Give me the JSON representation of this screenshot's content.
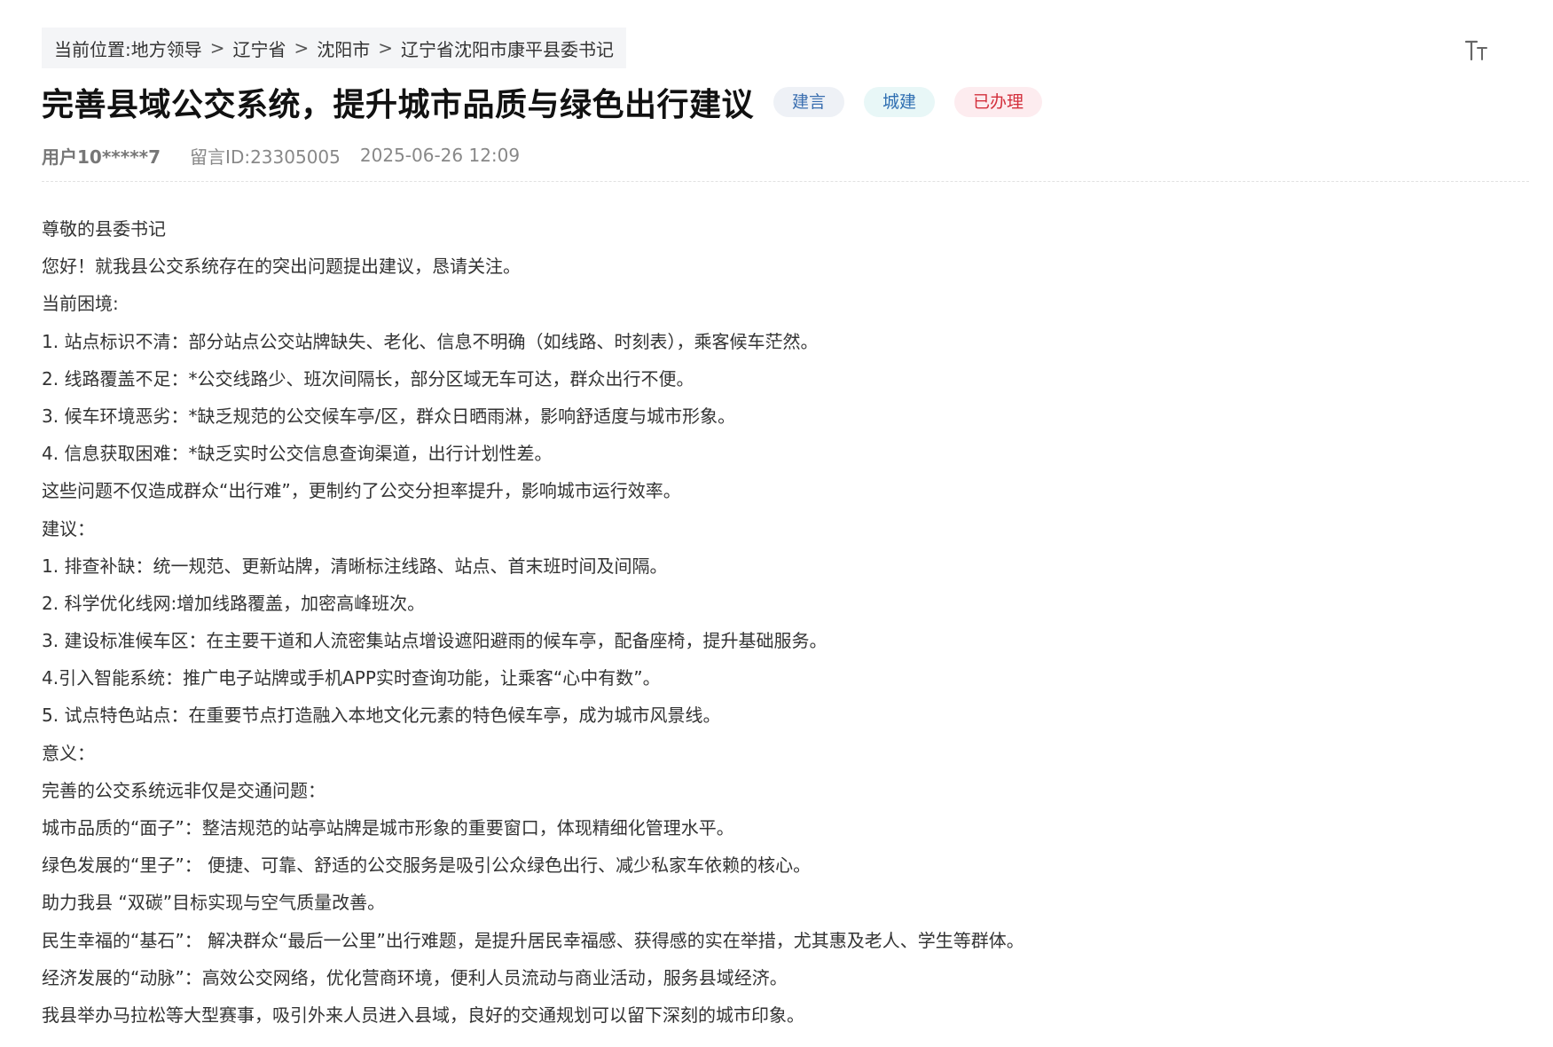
{
  "breadcrumb": {
    "prefix": "当前位置:",
    "items": [
      "地方领导",
      "辽宁省",
      "沈阳市",
      "辽宁省沈阳市康平县委书记"
    ],
    "separator": ">"
  },
  "toolbar": {
    "font_size_icon": "font-size-icon"
  },
  "post": {
    "title": "完善县域公交系统，提升城市品质与绿色出行建议",
    "tags": {
      "type": "建言",
      "category": "城建",
      "status": "已办理"
    },
    "meta": {
      "user": "用户10*****7",
      "message_id": "留言ID:23305005",
      "datetime": "2025-06-26 12:09"
    },
    "body": [
      "尊敬的县委书记",
      "您好！就我县公交系统存在的突出问题提出建议，恳请关注。",
      "当前困境:",
      "1.  站点标识不清：部分站点公交站牌缺失、老化、信息不明确（如线路、时刻表），乘客候车茫然。",
      "2.  线路覆盖不足：*公交线路少、班次间隔长，部分区域无车可达，群众出行不便。",
      "3.  候车环境恶劣：*缺乏规范的公交候车亭/区，群众日晒雨淋，影响舒适度与城市形象。",
      "4.  信息获取困难：*缺乏实时公交信息查询渠道，出行计划性差。",
      "这些问题不仅造成群众“出行难”，更制约了公交分担率提升，影响城市运行效率。",
      "建议：",
      "1.  排查补缺：统一规范、更新站牌，清晰标注线路、站点、首末班时间及间隔。",
      "2.  科学优化线网:增加线路覆盖，加密高峰班次。",
      "3.  建设标准候车区：在主要干道和人流密集站点增设遮阳避雨的候车亭，配备座椅，提升基础服务。",
      "4.引入智能系统：推广电子站牌或手机APP实时查询功能，让乘客“心中有数”。",
      "5. 试点特色站点：在重要节点打造融入本地文化元素的特色候车亭，成为城市风景线。",
      "意义：",
      "完善的公交系统远非仅是交通问题：",
      "城市品质的“面子”：整洁规范的站亭站牌是城市形象的重要窗口，体现精细化管理水平。",
      "绿色发展的“里子”： 便捷、可靠、舒适的公交服务是吸引公众绿色出行、减少私家车依赖的核心。",
      "助力我县 “双碳”目标实现与空气质量改善。",
      "民生幸福的“基石”： 解决群众“最后一公里”出行难题，是提升居民幸福感、获得感的实在举措，尤其惠及老人、学生等群体。",
      "经济发展的“动脉”：高效公交网络，优化营商环境，便利人员流动与商业活动，服务县域经济。",
      "我县举办马拉松等大型赛事，吸引外来人员进入县域，良好的交通规划可以留下深刻的城市印象。"
    ]
  }
}
